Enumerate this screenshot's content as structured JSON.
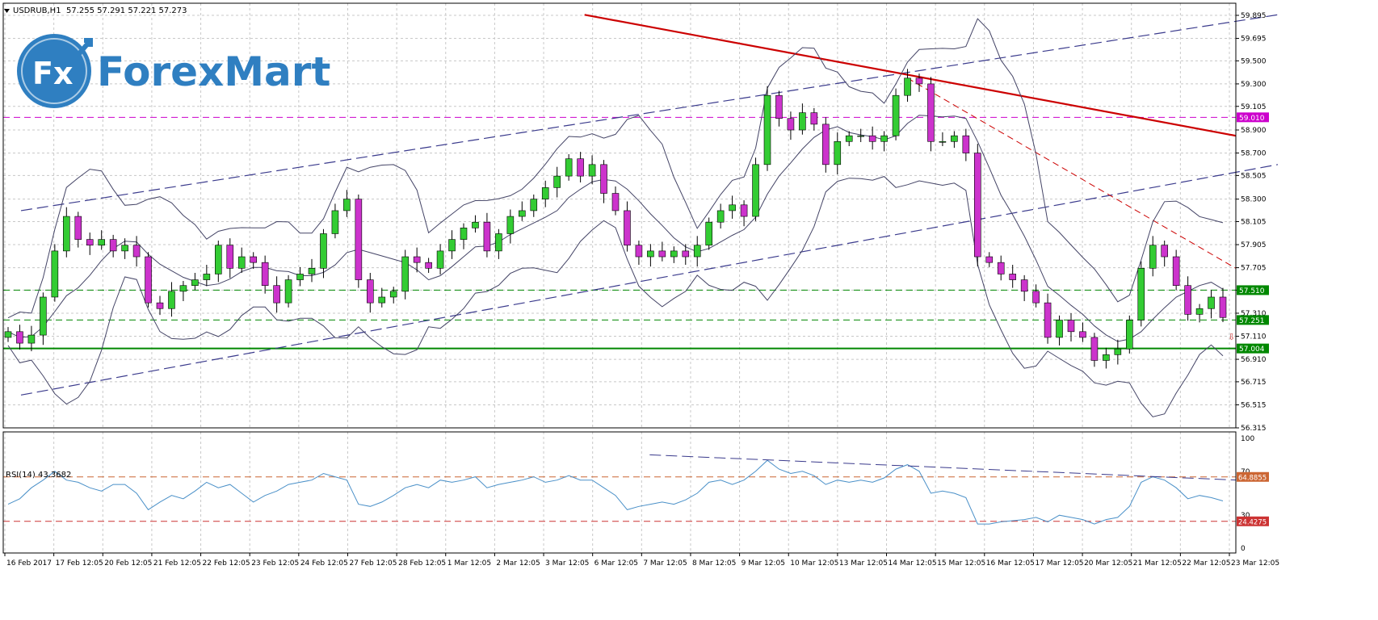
{
  "header": {
    "symbol_timeframe": "USDRUB,H1",
    "ohlc": "57.255 57.291 57.221 57.273"
  },
  "logo": {
    "text": "ForexMart",
    "badge_text": "Fx"
  },
  "colors": {
    "bull_candle": "#33cc33",
    "bear_candle": "#cc33cc",
    "bollinger": "#444466",
    "channel": "#3a3a8c",
    "red_trendline": "#cc0000",
    "support_line": "#008800",
    "magenta_level": "#cc00cc",
    "rsi_line": "#4a90c8",
    "rsi_levels": "#cc3333",
    "grid": "#c8c8c8"
  },
  "chart_data": [
    {
      "type": "candlestick",
      "price_range": [
        56.315,
        60.0
      ],
      "price_axis_ticks": [
        "59.895",
        "59.695",
        "59.500",
        "59.300",
        "59.105",
        "58.900",
        "58.700",
        "58.505",
        "58.300",
        "58.105",
        "57.905",
        "57.705",
        "57.510",
        "57.310",
        "57.110",
        "56.910",
        "56.715",
        "56.515",
        "56.315"
      ],
      "time_axis_labels": [
        "16 Feb 2017",
        "17 Feb 12:05",
        "20 Feb 12:05",
        "21 Feb 12:05",
        "22 Feb 12:05",
        "23 Feb 12:05",
        "24 Feb 12:05",
        "27 Feb 12:05",
        "28 Feb 12:05",
        "1 Mar 12:05",
        "2 Mar 12:05",
        "3 Mar 12:05",
        "6 Mar 12:05",
        "7 Mar 12:05",
        "8 Mar 12:05",
        "9 Mar 12:05",
        "10 Mar 12:05",
        "13 Mar 12:05",
        "14 Mar 12:05",
        "15 Mar 12:05",
        "16 Mar 12:05",
        "17 Mar 12:05",
        "20 Mar 12:05",
        "21 Mar 12:05",
        "22 Mar 12:05",
        "23 Mar 12:05"
      ],
      "price_tags": [
        {
          "value": "59.010",
          "color": "#cc00cc"
        },
        {
          "value": "57.510",
          "color": "#008800"
        },
        {
          "value": "57.251",
          "color": "#008800"
        },
        {
          "value": "57.004",
          "color": "#008800"
        }
      ],
      "horizontal_levels": [
        {
          "price": 59.01,
          "style": "dashed",
          "color": "#cc00cc"
        },
        {
          "price": 57.51,
          "style": "dashed",
          "color": "#008800"
        },
        {
          "price": 57.251,
          "style": "dashed",
          "color": "#008800"
        },
        {
          "price": 57.004,
          "style": "solid",
          "color": "#008800"
        }
      ],
      "close_path": [
        57.15,
        57.05,
        57.12,
        57.45,
        57.85,
        58.15,
        57.95,
        57.9,
        57.95,
        57.85,
        57.9,
        57.8,
        57.4,
        57.35,
        57.5,
        57.55,
        57.6,
        57.65,
        57.9,
        57.7,
        57.8,
        57.75,
        57.55,
        57.4,
        57.6,
        57.65,
        57.7,
        58.0,
        58.2,
        58.3,
        57.6,
        57.4,
        57.45,
        57.5,
        57.8,
        57.75,
        57.7,
        57.85,
        57.95,
        58.05,
        58.1,
        57.85,
        58.0,
        58.15,
        58.2,
        58.3,
        58.4,
        58.5,
        58.65,
        58.5,
        58.6,
        58.35,
        58.2,
        57.9,
        57.8,
        57.85,
        57.8,
        57.85,
        57.8,
        57.9,
        58.1,
        58.2,
        58.25,
        58.15,
        58.6,
        59.2,
        59.0,
        58.9,
        59.05,
        58.95,
        58.6,
        58.8,
        58.85,
        58.85,
        58.8,
        58.85,
        59.2,
        59.35,
        59.3,
        58.8,
        58.8,
        58.85,
        58.7,
        57.8,
        57.75,
        57.65,
        57.6,
        57.5,
        57.4,
        57.1,
        57.25,
        57.15,
        57.1,
        56.9,
        56.95,
        57.0,
        57.25,
        57.7,
        57.9,
        57.8,
        57.55,
        57.3,
        57.35,
        57.45,
        57.273
      ],
      "channel_lines": [
        {
          "from": [
            "16 Feb 2017",
            58.2
          ],
          "to": [
            "23 Mar 12:05",
            59.9
          ]
        },
        {
          "from": [
            "16 Feb 2017",
            56.6
          ],
          "to": [
            "23 Mar 12:05",
            58.6
          ]
        }
      ],
      "red_trendline": {
        "from": [
          "6 Mar 12:05",
          59.9
        ],
        "to": [
          "23 Mar 12:05",
          58.85
        ]
      }
    },
    {
      "type": "line",
      "title": "RSI(14) 43.3682",
      "ylim": [
        0,
        100
      ],
      "axis_ticks": [
        "100",
        "70",
        "30",
        "0"
      ],
      "levels": [
        {
          "value": "64.8855",
          "color": "#cc6633"
        },
        {
          "value": "24.4275",
          "color": "#cc3333"
        }
      ],
      "series": [
        {
          "name": "RSI(14)",
          "values": [
            40,
            45,
            55,
            62,
            70,
            62,
            60,
            55,
            52,
            58,
            58,
            50,
            35,
            42,
            48,
            45,
            52,
            60,
            55,
            58,
            50,
            42,
            48,
            52,
            58,
            60,
            62,
            68,
            65,
            62,
            40,
            38,
            42,
            48,
            55,
            58,
            55,
            62,
            60,
            62,
            65,
            55,
            58,
            60,
            62,
            65,
            60,
            62,
            66,
            62,
            62,
            55,
            48,
            35,
            38,
            40,
            42,
            40,
            44,
            50,
            60,
            62,
            58,
            62,
            70,
            80,
            72,
            68,
            70,
            66,
            58,
            62,
            60,
            62,
            60,
            64,
            72,
            76,
            70,
            50,
            52,
            50,
            46,
            22,
            22,
            24,
            25,
            26,
            28,
            24,
            30,
            28,
            26,
            22,
            26,
            28,
            38,
            60,
            65,
            62,
            55,
            45,
            48,
            46,
            43
          ]
        }
      ]
    }
  ]
}
